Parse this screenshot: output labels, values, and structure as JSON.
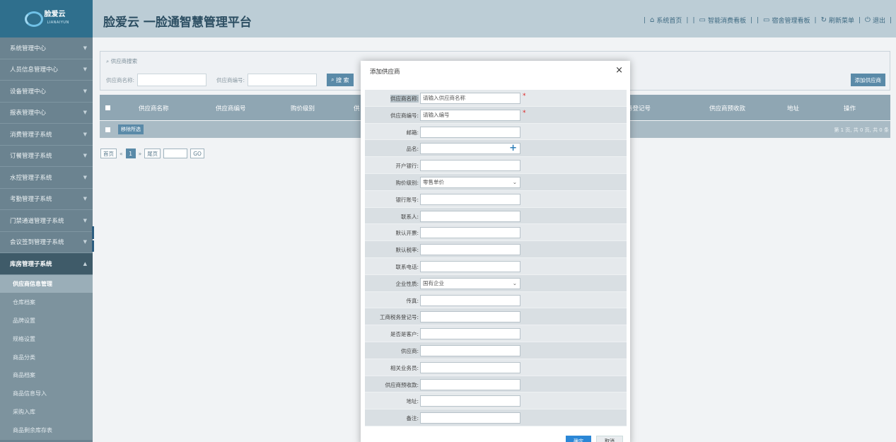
{
  "header": {
    "logo_text": "脸爱云",
    "logo_sub": "LIANAIYUN",
    "title": "脸爱云 一脸通智慧管理平台",
    "nav": [
      {
        "icon": "home-icon",
        "label": "系统首页"
      },
      {
        "icon": "board-icon",
        "label": "智能消费看板"
      },
      {
        "icon": "board-icon",
        "label": "宿舍管理看板"
      },
      {
        "icon": "refresh-icon",
        "label": "刷新菜单"
      },
      {
        "icon": "power-icon",
        "label": "退出"
      }
    ]
  },
  "sidebar": {
    "items": [
      {
        "label": "系统管理中心"
      },
      {
        "label": "人员信息管理中心"
      },
      {
        "label": "设备管理中心"
      },
      {
        "label": "报表管理中心"
      },
      {
        "label": "消费管理子系统"
      },
      {
        "label": "订餐管理子系统"
      },
      {
        "label": "水控管理子系统"
      },
      {
        "label": "考勤管理子系统"
      },
      {
        "label": "门禁通道管理子系统"
      },
      {
        "label": "会议签到管理子系统"
      },
      {
        "label": "库房管理子系统"
      }
    ],
    "sub_items": [
      {
        "label": "供应商信息管理"
      },
      {
        "label": "仓库档案"
      },
      {
        "label": "品牌设置"
      },
      {
        "label": "规格设置"
      },
      {
        "label": "商品分类"
      },
      {
        "label": "商品档案"
      },
      {
        "label": "商品信息导入"
      },
      {
        "label": "采购入库"
      },
      {
        "label": "商品剩余库存表"
      }
    ]
  },
  "search": {
    "legend": "供应商搜索",
    "name_label": "供应商名称:",
    "code_label": "供应商编号:",
    "search_btn": "搜 索",
    "add_btn": "添加供应商"
  },
  "grid": {
    "headers": [
      "供应商名称",
      "供应商编号",
      "购价级别",
      "供",
      "务登记号",
      "供应商预收款",
      "地址",
      "操作"
    ],
    "remove_btn": "移除所选",
    "page_info": "第 1 页, 共 0 页, 共 0 条"
  },
  "pager": {
    "first": "首页",
    "prev": "«",
    "current": "1",
    "next": "»",
    "last": "尾页",
    "go": "GO"
  },
  "modal": {
    "title": "添加供应商",
    "close": "×",
    "fields": [
      {
        "label": "供应商名称:",
        "value": "请输入供应商名称",
        "required": true,
        "kind": "input"
      },
      {
        "label": "供应商编号:",
        "value": "请输入编号",
        "required": true,
        "kind": "input"
      },
      {
        "label": "邮箱:",
        "value": "",
        "kind": "input"
      },
      {
        "label": "品名:",
        "value": "",
        "kind": "plus"
      },
      {
        "label": "开户银行:",
        "value": "",
        "kind": "input"
      },
      {
        "label": "购价级别:",
        "value": "零售单价",
        "kind": "select"
      },
      {
        "label": "银行账号:",
        "value": "",
        "kind": "input"
      },
      {
        "label": "联系人:",
        "value": "",
        "kind": "input"
      },
      {
        "label": "默认开票:",
        "value": "",
        "kind": "input"
      },
      {
        "label": "默认税率:",
        "value": "",
        "kind": "input"
      },
      {
        "label": "联系电话:",
        "value": "",
        "kind": "input"
      },
      {
        "label": "企业性质:",
        "value": "国有企业",
        "kind": "select"
      },
      {
        "label": "传真:",
        "value": "",
        "kind": "input"
      },
      {
        "label": "工商税务登记号:",
        "value": "",
        "kind": "input"
      },
      {
        "label": "是否是客户:",
        "value": "",
        "kind": "input"
      },
      {
        "label": "供应商:",
        "value": "",
        "kind": "input"
      },
      {
        "label": "相关业务员:",
        "value": "",
        "kind": "input"
      },
      {
        "label": "供应商预收款:",
        "value": "",
        "kind": "input"
      },
      {
        "label": "地址:",
        "value": "",
        "kind": "input"
      },
      {
        "label": "备注:",
        "value": "",
        "kind": "input"
      }
    ],
    "ok": "确定",
    "cancel": "取消"
  }
}
